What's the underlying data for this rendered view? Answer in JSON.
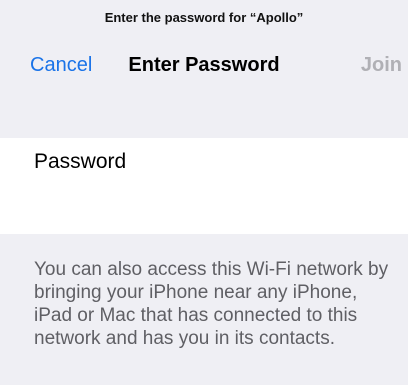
{
  "prompt": "Enter the password for “Apollo”",
  "navbar": {
    "cancel_label": "Cancel",
    "title": "Enter Password",
    "join_label": "Join"
  },
  "form": {
    "password_label": "Password",
    "password_value": ""
  },
  "footnote": "You can also access this Wi-Fi network by bringing your iPhone near any iPhone, iPad or Mac that has connected to this network and has you in its contacts.",
  "colors": {
    "accent": "#1a73e8",
    "disabled": "#b0b0b5",
    "background": "#efeff4"
  }
}
